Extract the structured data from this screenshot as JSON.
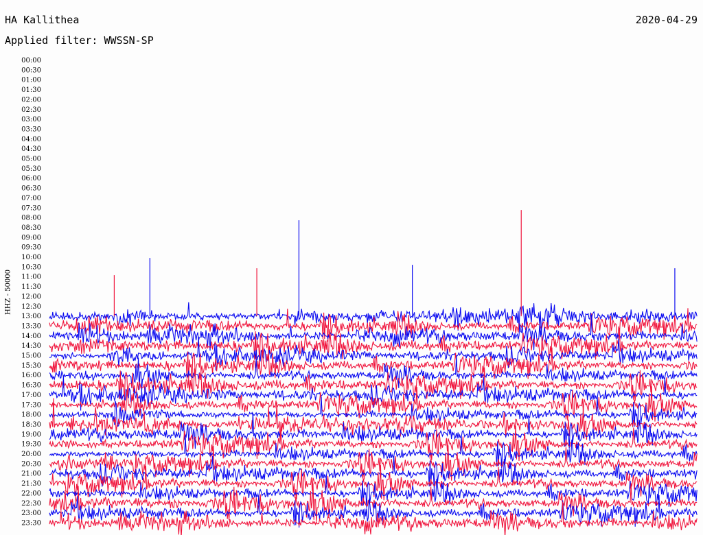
{
  "header": {
    "station": "HA Kallithea",
    "date": "2020-04-29",
    "filter": "Applied filter: WWSSN-SP",
    "channel": "HHZ - 50000"
  },
  "chart_data": {
    "type": "line",
    "title": "HA Kallithea",
    "subtitle": "Applied filter: WWSSN-SP",
    "ylabel": "HHZ - 50000",
    "y_tick_labels": [
      "00:00",
      "00:30",
      "01:00",
      "01:30",
      "02:00",
      "02:30",
      "03:00",
      "03:30",
      "04:00",
      "04:30",
      "05:00",
      "05:30",
      "06:00",
      "06:30",
      "07:00",
      "07:30",
      "08:00",
      "08:30",
      "09:00",
      "09:30",
      "10:00",
      "10:30",
      "11:00",
      "11:30",
      "12:00",
      "12:30",
      "13:00",
      "13:30",
      "14:00",
      "14:30",
      "15:00",
      "15:30",
      "16:00",
      "16:30",
      "17:00",
      "17:30",
      "18:00",
      "18:30",
      "19:00",
      "19:30",
      "20:00",
      "20:30",
      "21:00",
      "21:30",
      "22:00",
      "22:30",
      "23:00",
      "23:30"
    ],
    "active_from": "13:00",
    "trace_colors": [
      "#0a0af0",
      "#f0143c"
    ],
    "colors": {
      "blue": "#0a0af0",
      "red": "#f0143c"
    },
    "spikes": [
      {
        "row": "13:00",
        "x_frac": 0.385,
        "height": 140,
        "color": "#0a0af0"
      },
      {
        "row": "13:00",
        "x_frac": 0.728,
        "height": 155,
        "color": "#f0143c"
      },
      {
        "row": "13:00",
        "x_frac": 0.155,
        "height": 85,
        "color": "#0a0af0"
      },
      {
        "row": "13:00",
        "x_frac": 0.56,
        "height": 75,
        "color": "#0a0af0"
      },
      {
        "row": "13:00",
        "x_frac": 0.32,
        "height": 70,
        "color": "#f0143c"
      },
      {
        "row": "13:00",
        "x_frac": 0.965,
        "height": 70,
        "color": "#0a0af0"
      },
      {
        "row": "13:00",
        "x_frac": 0.1,
        "height": 60,
        "color": "#f0143c"
      }
    ]
  }
}
